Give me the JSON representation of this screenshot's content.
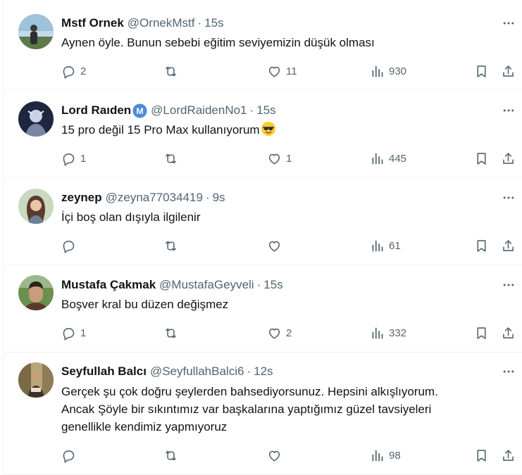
{
  "tweets": [
    {
      "display_name": "Mstf Ornek",
      "handle": "@OrnekMstf",
      "separator": "·",
      "time": "15s",
      "lines": [
        "Aynen öyle. Bunun sebebi eğitim seviyemizin düşük olması"
      ],
      "replies": "2",
      "retweets": "",
      "likes": "11",
      "views": "930",
      "avatar": {
        "bg": "#8fb0c8",
        "fg": "#4a5a66"
      }
    },
    {
      "display_name": "Lord Raıden",
      "handle": "@LordRaidenNo1",
      "separator": "·",
      "time": "15s",
      "lines": [
        "15 pro değil 15 Pro Max kullanıyorum"
      ],
      "trailing_emoji": "smiling-face-with-sunglasses",
      "verified_badge": "M",
      "verified_color": "#4b8bd6",
      "replies": "1",
      "retweets": "",
      "likes": "1",
      "views": "445",
      "avatar": {
        "bg": "#1f2740",
        "fg": "#c9d2e6"
      }
    },
    {
      "display_name": "zeynep",
      "handle": "@zeyna77034419",
      "separator": "·",
      "time": "9s",
      "lines": [
        "İçi boş olan dışıyla ilgilenir"
      ],
      "replies": "",
      "retweets": "",
      "likes": "",
      "views": "61",
      "avatar": {
        "bg": "#c8d9c0",
        "fg": "#5b3b2a"
      }
    },
    {
      "display_name": "Mustafa Çakmak",
      "handle": "@MustafaGeyveli",
      "separator": "·",
      "time": "15s",
      "lines": [
        "Boşver kral bu düzen değişmez"
      ],
      "replies": "1",
      "retweets": "",
      "likes": "2",
      "views": "332",
      "avatar": {
        "bg": "#6b8f4e",
        "fg": "#5a3a2c"
      }
    },
    {
      "display_name": "Seyfullah Balcı",
      "handle": "@SeyfullahBalci6",
      "separator": "·",
      "time": "12s",
      "lines": [
        "Gerçek şu çok doğru şeylerden bahsediyorsunuz. Hepsini alkışlıyorum.",
        "Ancak Şöyle bir sıkıntımız var başkalarına yaptığımız güzel tavsiyeleri",
        "genellikle kendimiz yapmıyoruz"
      ],
      "replies": "",
      "retweets": "",
      "likes": "",
      "views": "98",
      "avatar": {
        "bg": "#a08a5a",
        "fg": "#3b3326"
      }
    }
  ],
  "icons": {
    "more": "more-icon",
    "reply": "reply-icon",
    "retweet": "retweet-icon",
    "like": "like-icon",
    "views": "views-icon",
    "bookmark": "bookmark-icon",
    "share": "share-icon"
  },
  "colors": {
    "text": "#0f1419",
    "secondary": "#536471",
    "divider": "#eff3f4",
    "verified": "#4b8bd6"
  }
}
